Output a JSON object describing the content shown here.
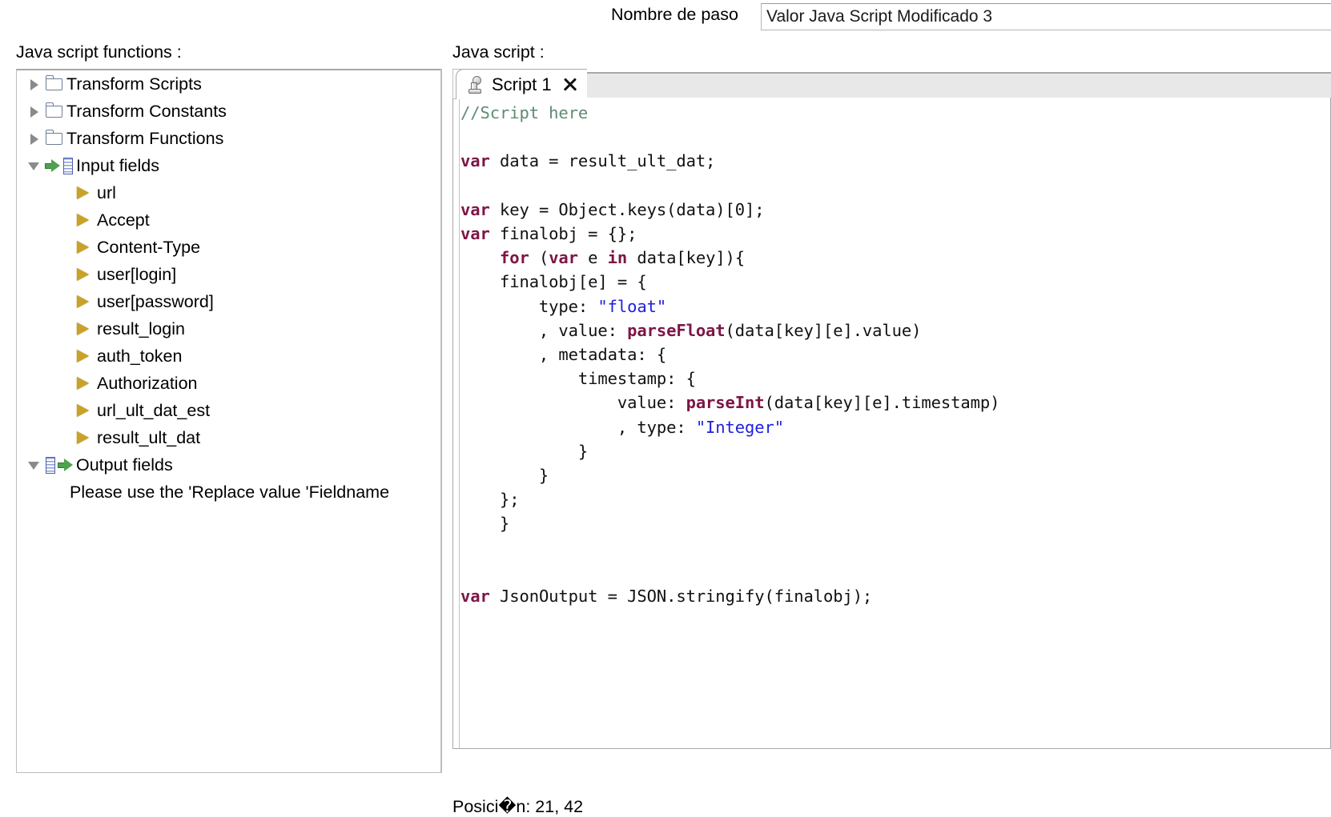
{
  "header": {
    "step_name_label": "Nombre de paso",
    "step_name_value": "Valor Java Script Modificado 3",
    "step_name_placeholder": "Nombre de paso"
  },
  "left_panel": {
    "caption": "Java script functions :",
    "tree": [
      {
        "label": "Transform Scripts",
        "level": 0,
        "twisty": "closed",
        "icon": "folder-icon"
      },
      {
        "label": "Transform Constants",
        "level": 0,
        "twisty": "closed",
        "icon": "folder-icon"
      },
      {
        "label": "Transform Functions",
        "level": 0,
        "twisty": "closed",
        "icon": "folder-icon"
      },
      {
        "label": "Input fields",
        "level": 0,
        "twisty": "open",
        "icon": "input-fields-icon"
      },
      {
        "label": "url",
        "level": 1,
        "twisty": "none",
        "icon": "field-arrow-icon"
      },
      {
        "label": "Accept",
        "level": 1,
        "twisty": "none",
        "icon": "field-arrow-icon"
      },
      {
        "label": "Content-Type",
        "level": 1,
        "twisty": "none",
        "icon": "field-arrow-icon"
      },
      {
        "label": "user[login]",
        "level": 1,
        "twisty": "none",
        "icon": "field-arrow-icon"
      },
      {
        "label": "user[password]",
        "level": 1,
        "twisty": "none",
        "icon": "field-arrow-icon"
      },
      {
        "label": "result_login",
        "level": 1,
        "twisty": "none",
        "icon": "field-arrow-icon"
      },
      {
        "label": "auth_token",
        "level": 1,
        "twisty": "none",
        "icon": "field-arrow-icon"
      },
      {
        "label": "Authorization",
        "level": 1,
        "twisty": "none",
        "icon": "field-arrow-icon"
      },
      {
        "label": "url_ult_dat_est",
        "level": 1,
        "twisty": "none",
        "icon": "field-arrow-icon"
      },
      {
        "label": "result_ult_dat",
        "level": 1,
        "twisty": "none",
        "icon": "field-arrow-icon"
      },
      {
        "label": "Output fields",
        "level": 0,
        "twisty": "open",
        "icon": "output-fields-icon"
      }
    ],
    "note": "Please use the 'Replace value 'Fieldname"
  },
  "right_panel": {
    "caption": "Java script :",
    "tab": {
      "title": "Script 1",
      "icon": "script-icon",
      "close_icon": "close-icon"
    },
    "code_lines": [
      [
        {
          "t": "//Script here",
          "c": "cmt"
        }
      ],
      [],
      [
        {
          "t": "var",
          "c": "kw"
        },
        {
          "t": " data = result_ult_dat;",
          "c": ""
        }
      ],
      [],
      [
        {
          "t": "var",
          "c": "kw"
        },
        {
          "t": " key = Object.keys(data)[0];",
          "c": ""
        }
      ],
      [
        {
          "t": "var",
          "c": "kw"
        },
        {
          "t": " finalobj = {};",
          "c": ""
        }
      ],
      [
        {
          "t": "    ",
          "c": ""
        },
        {
          "t": "for",
          "c": "kw"
        },
        {
          "t": " (",
          "c": ""
        },
        {
          "t": "var",
          "c": "kw"
        },
        {
          "t": " e ",
          "c": ""
        },
        {
          "t": "in",
          "c": "kw"
        },
        {
          "t": " data[key]){",
          "c": ""
        }
      ],
      [
        {
          "t": "    finalobj[e] = {",
          "c": ""
        }
      ],
      [
        {
          "t": "        type: ",
          "c": ""
        },
        {
          "t": "\"float\"",
          "c": "str"
        }
      ],
      [
        {
          "t": "        , value: ",
          "c": ""
        },
        {
          "t": "parseFloat",
          "c": "fn"
        },
        {
          "t": "(data[key][e].value)",
          "c": ""
        }
      ],
      [
        {
          "t": "        , metadata: {",
          "c": ""
        }
      ],
      [
        {
          "t": "            timestamp: {",
          "c": ""
        }
      ],
      [
        {
          "t": "                value: ",
          "c": ""
        },
        {
          "t": "parseInt",
          "c": "fn"
        },
        {
          "t": "(data[key][e].timestamp)",
          "c": ""
        }
      ],
      [
        {
          "t": "                , type: ",
          "c": ""
        },
        {
          "t": "\"Integer\"",
          "c": "str"
        }
      ],
      [
        {
          "t": "            }",
          "c": ""
        }
      ],
      [
        {
          "t": "        }",
          "c": ""
        }
      ],
      [
        {
          "t": "    };",
          "c": ""
        }
      ],
      [
        {
          "t": "    }",
          "c": ""
        }
      ],
      [],
      [],
      [
        {
          "t": "var",
          "c": "kw"
        },
        {
          "t": " JsonOutput = JSON.stringify(finalobj);",
          "c": ""
        }
      ]
    ],
    "status": "Posici�n: 21, 42"
  },
  "colors": {
    "keyword": "#7c1646",
    "string": "#2020dd",
    "comment": "#5f8b72",
    "tab_strip": "#e8e8e8",
    "border": "#a8a8a8"
  }
}
